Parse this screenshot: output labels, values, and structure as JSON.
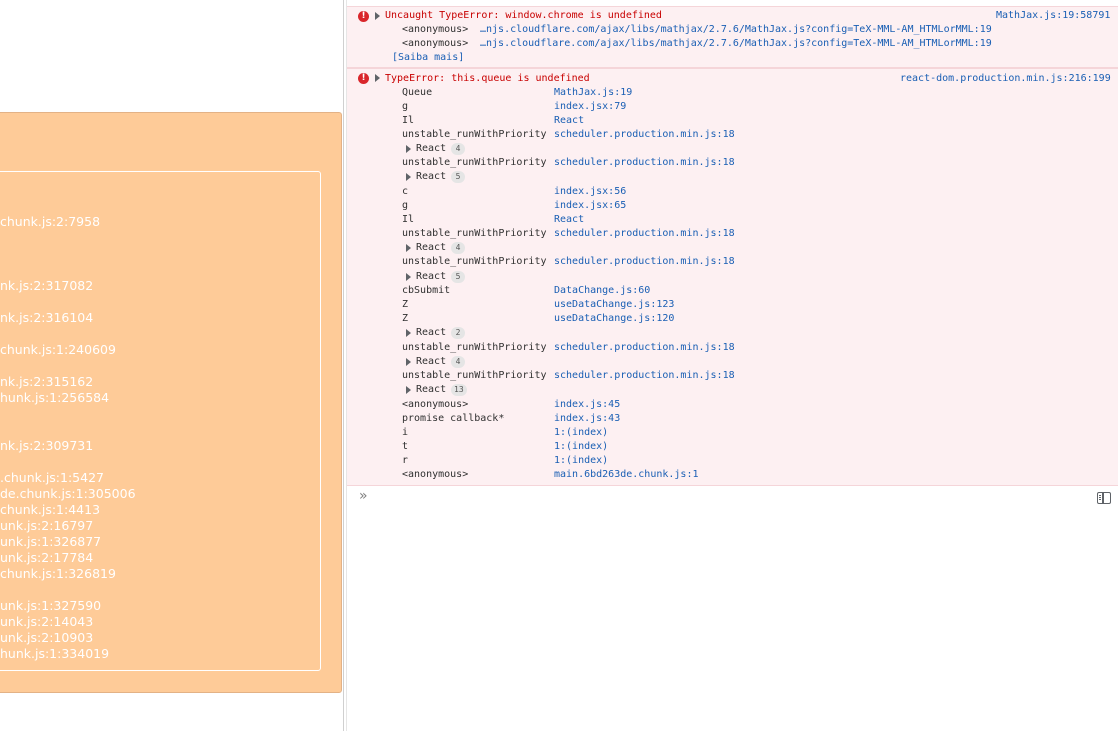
{
  "page_panel": {
    "stack_lines": [
      "chunk.js:2:7958",
      "nk.js:2:317082",
      "nk.js:2:316104",
      "chunk.js:1:240609",
      "nk.js:2:315162",
      "hunk.js:1:256584",
      "nk.js:2:309731",
      ".chunk.js:1:5427",
      "de.chunk.js:1:305006",
      "chunk.js:1:4413",
      "unk.js:2:16797",
      "unk.js:1:326877",
      "unk.js:2:17784",
      "chunk.js:1:326819",
      "unk.js:1:327590",
      "unk.js:2:14043",
      "unk.js:2:10903",
      "hunk.js:1:334019"
    ]
  },
  "console": {
    "error1": {
      "message": "Uncaught TypeError: window.chrome is undefined",
      "source": "MathJax.js:19:58791",
      "frames": [
        {
          "fn": "<anonymous>",
          "loc": "…njs.cloudflare.com/ajax/libs/mathjax/2.7.6/MathJax.js?config=TeX-MML-AM_HTMLorMML:19"
        },
        {
          "fn": "<anonymous>",
          "loc": "…njs.cloudflare.com/ajax/libs/mathjax/2.7.6/MathJax.js?config=TeX-MML-AM_HTMLorMML:19"
        }
      ],
      "learn_more": "[Saiba mais]"
    },
    "error2": {
      "message": "TypeError: this.queue is undefined",
      "source": "react-dom.production.min.js:216:199",
      "rows": [
        {
          "kind": "frame",
          "fn": "Queue",
          "loc": "MathJax.js:19"
        },
        {
          "kind": "frame",
          "fn": "g",
          "loc": "index.jsx:79"
        },
        {
          "kind": "frame",
          "fn": "Il",
          "loc": "React"
        },
        {
          "kind": "frame",
          "fn": "unstable_runWithPriority",
          "loc": "scheduler.production.min.js:18"
        },
        {
          "kind": "group",
          "label": "React",
          "count": "4"
        },
        {
          "kind": "frame",
          "fn": "unstable_runWithPriority",
          "loc": "scheduler.production.min.js:18"
        },
        {
          "kind": "group",
          "label": "React",
          "count": "5"
        },
        {
          "kind": "frame",
          "fn": "c",
          "loc": "index.jsx:56"
        },
        {
          "kind": "frame",
          "fn": "g",
          "loc": "index.jsx:65"
        },
        {
          "kind": "frame",
          "fn": "Il",
          "loc": "React"
        },
        {
          "kind": "frame",
          "fn": "unstable_runWithPriority",
          "loc": "scheduler.production.min.js:18"
        },
        {
          "kind": "group",
          "label": "React",
          "count": "4"
        },
        {
          "kind": "frame",
          "fn": "unstable_runWithPriority",
          "loc": "scheduler.production.min.js:18"
        },
        {
          "kind": "group",
          "label": "React",
          "count": "5"
        },
        {
          "kind": "frame",
          "fn": "cbSubmit",
          "loc": "DataChange.js:60"
        },
        {
          "kind": "frame",
          "fn": "Z",
          "loc": "useDataChange.js:123"
        },
        {
          "kind": "frame",
          "fn": "Z",
          "loc": "useDataChange.js:120"
        },
        {
          "kind": "group",
          "label": "React",
          "count": "2"
        },
        {
          "kind": "frame",
          "fn": "unstable_runWithPriority",
          "loc": "scheduler.production.min.js:18"
        },
        {
          "kind": "group",
          "label": "React",
          "count": "4"
        },
        {
          "kind": "frame",
          "fn": "unstable_runWithPriority",
          "loc": "scheduler.production.min.js:18"
        },
        {
          "kind": "group",
          "label": "React",
          "count": "13"
        },
        {
          "kind": "frame",
          "fn": "<anonymous>",
          "loc": "index.js:45"
        },
        {
          "kind": "frame",
          "fn": "promise callback*",
          "loc": "index.js:43"
        },
        {
          "kind": "frame",
          "fn": "i",
          "loc": "1:(index)"
        },
        {
          "kind": "frame",
          "fn": "t",
          "loc": "1:(index)"
        },
        {
          "kind": "frame",
          "fn": "r",
          "loc": "1:(index)"
        },
        {
          "kind": "frame",
          "fn": "<anonymous>",
          "loc": "main.6bd263de.chunk.js:1"
        }
      ]
    },
    "prompt_symbol": "»",
    "error_icon_glyph": "!"
  },
  "colors": {
    "panel_bg": "#fecb98",
    "error_bg": "#fdf0f2",
    "error_text": "#c80000",
    "link": "#1a5fb4"
  },
  "icons": [
    "error-icon",
    "expand-triangle-icon",
    "console-prompt-icon",
    "sidebar-toggle-icon"
  ]
}
